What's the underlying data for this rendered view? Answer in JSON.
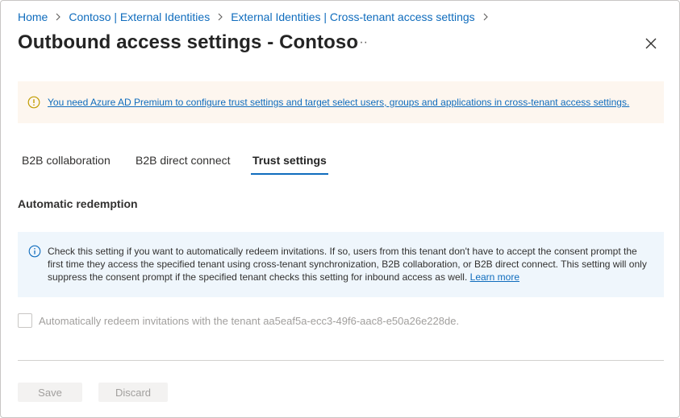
{
  "breadcrumb": {
    "items": [
      "Home",
      "Contoso | External Identities",
      "External Identities | Cross-tenant access settings"
    ]
  },
  "header": {
    "title": "Outbound access settings - Contoso",
    "more_glyph": "···",
    "close_icon": "close-icon"
  },
  "warning": {
    "icon": "warning-icon",
    "text": "You need Azure AD Premium to configure trust settings and target select users, groups and applications in cross-tenant access settings.",
    "color": "#fdf6ef",
    "icon_color": "#c19c00"
  },
  "tabs": [
    {
      "label": "B2B collaboration",
      "active": false
    },
    {
      "label": "B2B direct connect",
      "active": false
    },
    {
      "label": "Trust settings",
      "active": true
    }
  ],
  "section": {
    "heading": "Automatic redemption",
    "info": {
      "icon": "info-icon",
      "text": "Check this setting if you want to automatically redeem invitations. If so, users from this tenant don't have to accept the consent prompt the first time they access the specified tenant using cross-tenant synchronization, B2B collaboration, or B2B direct connect. This setting will only suppress the consent prompt if the specified tenant checks this setting for inbound access as well.",
      "link": "Learn more"
    },
    "checkbox": {
      "label": "Automatically redeem invitations with the tenant aa5eaf5a-ecc3-49f6-aac8-e50a26e228de.",
      "checked": false,
      "disabled": true
    }
  },
  "footer": {
    "save_label": "Save",
    "discard_label": "Discard"
  },
  "colors": {
    "accent": "#0f6cbd",
    "info_bg": "#eff6fc",
    "disabled_text": "#a19f9d"
  }
}
